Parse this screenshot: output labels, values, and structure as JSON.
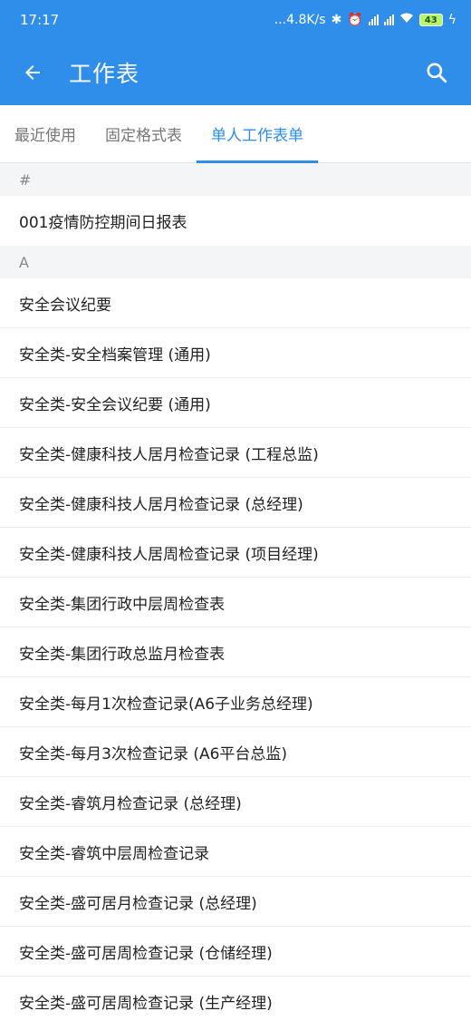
{
  "status": {
    "time": "17:17",
    "speed": "...4.8K/s",
    "battery": "43"
  },
  "appbar": {
    "title": "工作表",
    "back_icon": "arrow-left-icon",
    "search_icon": "search-icon"
  },
  "tabs": [
    {
      "label": "最近使用",
      "active": false
    },
    {
      "label": "固定格式表",
      "active": false
    },
    {
      "label": "单人工作表单",
      "active": true
    }
  ],
  "sections": [
    {
      "header": "#",
      "items": [
        "001疫情防控期间日报表"
      ]
    },
    {
      "header": "A",
      "items": [
        "安全会议纪要",
        "安全类-安全档案管理 (通用)",
        "安全类-安全会议纪要 (通用)",
        "安全类-健康科技人居月检查记录 (工程总监)",
        "安全类-健康科技人居月检查记录 (总经理)",
        "安全类-健康科技人居周检查记录 (项目经理)",
        "安全类-集团行政中层周检查表",
        "安全类-集团行政总监月检查表",
        "安全类-每月1次检查记录(A6子业务总经理)",
        "安全类-每月3次检查记录 (A6平台总监)",
        "安全类-睿筑月检查记录 (总经理)",
        "安全类-睿筑中层周检查记录",
        "安全类-盛可居月检查记录 (总经理)",
        "安全类-盛可居周检查记录 (仓储经理)",
        "安全类-盛可居周检查记录 (生产经理)"
      ]
    }
  ],
  "colors": {
    "primary": "#2f8eea",
    "section_bg": "#f4f5f7"
  }
}
